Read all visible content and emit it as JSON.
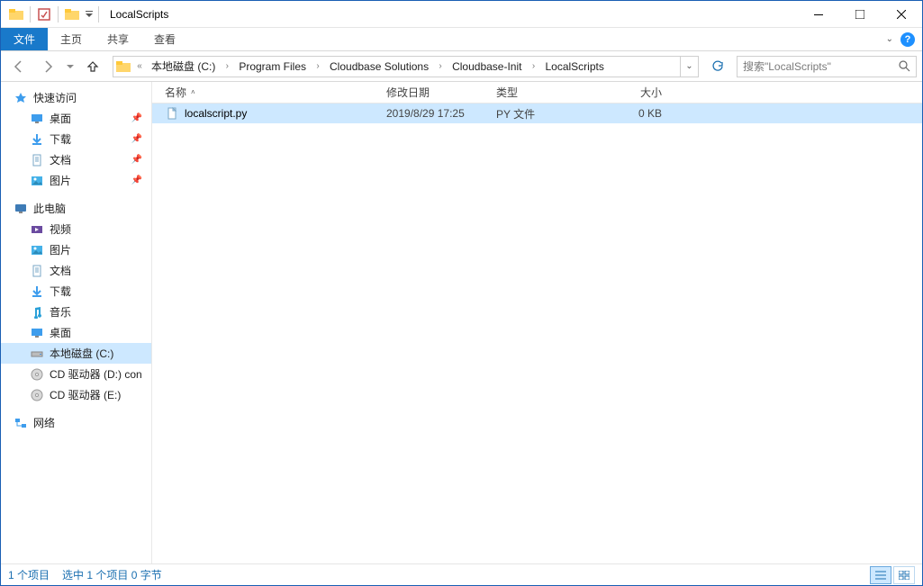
{
  "window": {
    "title": "LocalScripts"
  },
  "ribbon": {
    "file": "文件",
    "home": "主页",
    "share": "共享",
    "view": "查看"
  },
  "breadcrumbs": [
    "本地磁盘 (C:)",
    "Program Files",
    "Cloudbase Solutions",
    "Cloudbase-Init",
    "LocalScripts"
  ],
  "search": {
    "placeholder": "搜索\"LocalScripts\""
  },
  "sidebar": {
    "quick_access": "快速访问",
    "qa_items": [
      {
        "label": "桌面",
        "icon": "desktop",
        "pin": true
      },
      {
        "label": "下载",
        "icon": "download",
        "pin": true
      },
      {
        "label": "文档",
        "icon": "document",
        "pin": true
      },
      {
        "label": "图片",
        "icon": "pictures",
        "pin": true
      }
    ],
    "this_pc": "此电脑",
    "pc_items": [
      {
        "label": "视频",
        "icon": "video"
      },
      {
        "label": "图片",
        "icon": "pictures"
      },
      {
        "label": "文档",
        "icon": "document"
      },
      {
        "label": "下载",
        "icon": "download"
      },
      {
        "label": "音乐",
        "icon": "music"
      },
      {
        "label": "桌面",
        "icon": "desktop"
      },
      {
        "label": "本地磁盘 (C:)",
        "icon": "drive",
        "selected": true
      },
      {
        "label": "CD 驱动器 (D:) con",
        "icon": "disc"
      },
      {
        "label": "CD 驱动器 (E:)",
        "icon": "disc"
      }
    ],
    "network": "网络"
  },
  "columns": {
    "name": "名称",
    "date": "修改日期",
    "type": "类型",
    "size": "大小"
  },
  "files": [
    {
      "name": "localscript.py",
      "date": "2019/8/29 17:25",
      "type": "PY 文件",
      "size": "0 KB",
      "selected": true
    }
  ],
  "status": {
    "count": "1 个项目",
    "selection": "选中 1 个项目  0 字节"
  }
}
